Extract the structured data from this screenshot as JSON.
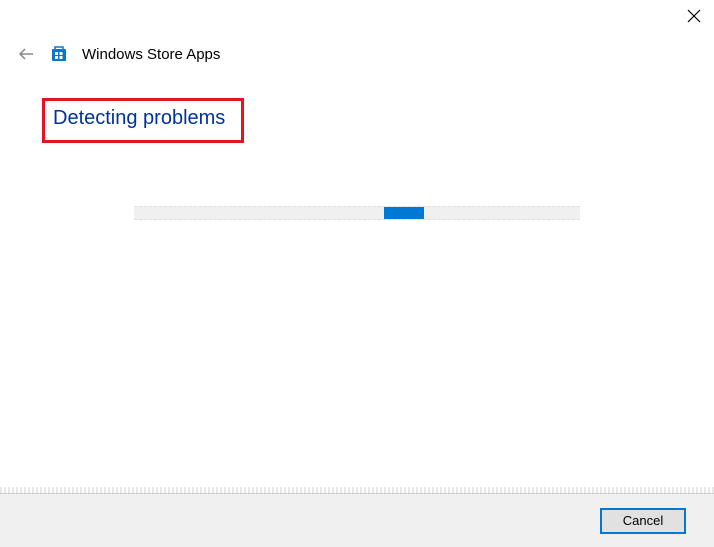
{
  "titlebar": {
    "close_icon": "close"
  },
  "header": {
    "back_icon": "back-arrow",
    "app_icon": "windows-store",
    "title": "Windows Store Apps"
  },
  "main": {
    "heading": "Detecting problems"
  },
  "footer": {
    "cancel_label": "Cancel"
  },
  "colors": {
    "accent": "#0078d4",
    "heading": "#003399",
    "highlight_border": "#e81123"
  }
}
